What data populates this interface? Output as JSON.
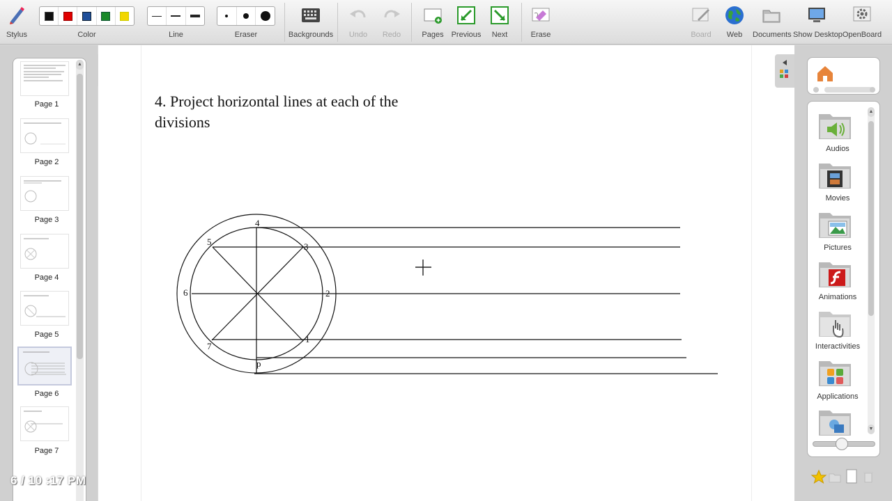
{
  "toolbar": {
    "stylus": "Stylus",
    "color": "Color",
    "line": "Line",
    "eraser": "Eraser",
    "backgrounds": "Backgrounds",
    "undo": "Undo",
    "redo": "Redo",
    "pages": "Pages",
    "previous": "Previous",
    "next": "Next",
    "erase": "Erase",
    "board": "Board",
    "web": "Web",
    "documents": "Documents",
    "show_desktop": "Show Desktop",
    "openboard": "OpenBoard"
  },
  "colors": [
    "#111111",
    "#e00000",
    "#1f4f9a",
    "#1a8a2a",
    "#f2d600"
  ],
  "pages": [
    {
      "label": "Page 1"
    },
    {
      "label": "Page 2"
    },
    {
      "label": "Page 3"
    },
    {
      "label": "Page 4"
    },
    {
      "label": "Page 5"
    },
    {
      "label": "Page 6"
    },
    {
      "label": "Page 7"
    }
  ],
  "selected_page": "Page 6",
  "clock": "6 / 10 :17 PM",
  "board": {
    "title_line1": "4. Project horizontal lines at each of the",
    "title_line2": "divisions",
    "division_labels": [
      "4",
      "5",
      "3",
      "6",
      "2",
      "7",
      "1",
      "p"
    ]
  },
  "library": [
    {
      "label": "Audios"
    },
    {
      "label": "Movies"
    },
    {
      "label": "Pictures"
    },
    {
      "label": "Animations"
    },
    {
      "label": "Interactivities"
    },
    {
      "label": "Applications"
    }
  ]
}
